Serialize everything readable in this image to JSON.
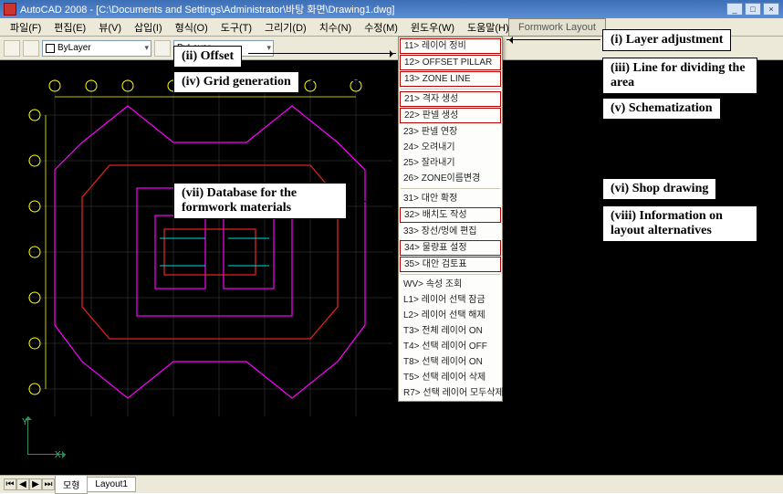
{
  "title": "AutoCAD 2008 - [C:\\Documents and Settings\\Administrator\\바탕 화면\\Drawing1.dwg]",
  "menus": {
    "file": "파일(F)",
    "edit": "편집(E)",
    "view": "뷰(V)",
    "insert": "삽입(I)",
    "format": "형식(O)",
    "tools": "도구(T)",
    "draw": "그리기(D)",
    "dimension": "치수(N)",
    "modify": "수정(M)",
    "window": "윈도우(W)",
    "help": "도움말(H)"
  },
  "bylayer": "ByLayer",
  "fw_tab": "Formwork Layout",
  "fw_items": {
    "i11": "11> 레이어 정비",
    "i12": "12> OFFSET PILLAR",
    "i13": "13> ZONE LINE",
    "i21": "21> 격자 생성",
    "i22": "22> 판넬 생성",
    "i23": "23> 판넬 연장",
    "i24": "24> 오려내기",
    "i25": "25> 잘라내기",
    "i26": "26> ZONE이름변경",
    "i31": "31> 대안 확정",
    "i32": "32> 배치도 작성",
    "i33": "33> 장선/멍에 편집",
    "i34": "34> 물량표 설정",
    "i35": "35> 대안 검토표",
    "wv": "WV> 속성 조회",
    "l1": "L1> 레이어 선택 잠금",
    "l2": "L2> 레이어 선택 해제",
    "t3": "T3> 전체 레이어 ON",
    "t4": "T4> 선택 레이어 OFF",
    "t8": "T8> 선택 레이어 ON",
    "t5": "T5> 선택 레이어 삭제",
    "r7": "R7> 선택 레이어 모두삭제"
  },
  "callouts": {
    "c1": "(i) Layer adjustment",
    "c2": "(ii) Offset",
    "c3": "(iii) Line for dividing the area",
    "c4": "(iv) Grid generation",
    "c5": "(v) Schematization",
    "c6": "(vi) Shop drawing",
    "c7": "(vii) Database for the formwork materials",
    "c8": "(viii) Information on layout alternatives"
  },
  "axes": {
    "x": "X",
    "y": "Y"
  },
  "tabs": {
    "model": "모형",
    "layout": "Layout1"
  }
}
